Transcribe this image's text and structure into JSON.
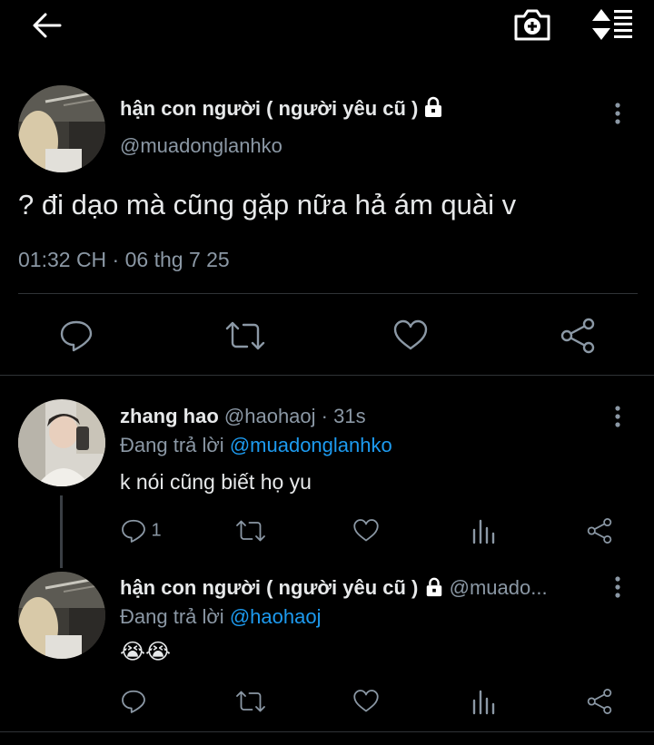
{
  "topbar": {
    "back_icon": "arrow-left-icon",
    "camera_icon": "camera-add-icon",
    "sort_icon": "sort-lines-icon"
  },
  "main_tweet": {
    "display_name": "hận con người ( người yêu cũ )",
    "handle": "@muadonglanhko",
    "text": "? đi dạo mà cũng gặp nữa hả ám quài v",
    "timestamp": "01:32 CH · 06 thg 7 25",
    "protected_icon": "lock-icon"
  },
  "replies": [
    {
      "display_name": "zhang hao",
      "handle": "@haohaoj",
      "time": "· 31s",
      "replying_prefix": "Đang trả lời",
      "replying_to": "@muadonglanhko",
      "text": "k nói cũng biết họ yu",
      "reply_count": "1"
    },
    {
      "display_name": "hận con người ( người yêu cũ )",
      "handle": "@muado...",
      "replying_prefix": "Đang trả lời",
      "replying_to": "@haohaoj",
      "text": "😭😭"
    }
  ],
  "colors": {
    "background": "#000000",
    "text": "#e7e9ea",
    "muted": "#8b98a5",
    "link": "#1d9bf0",
    "divider": "#2f3336"
  }
}
